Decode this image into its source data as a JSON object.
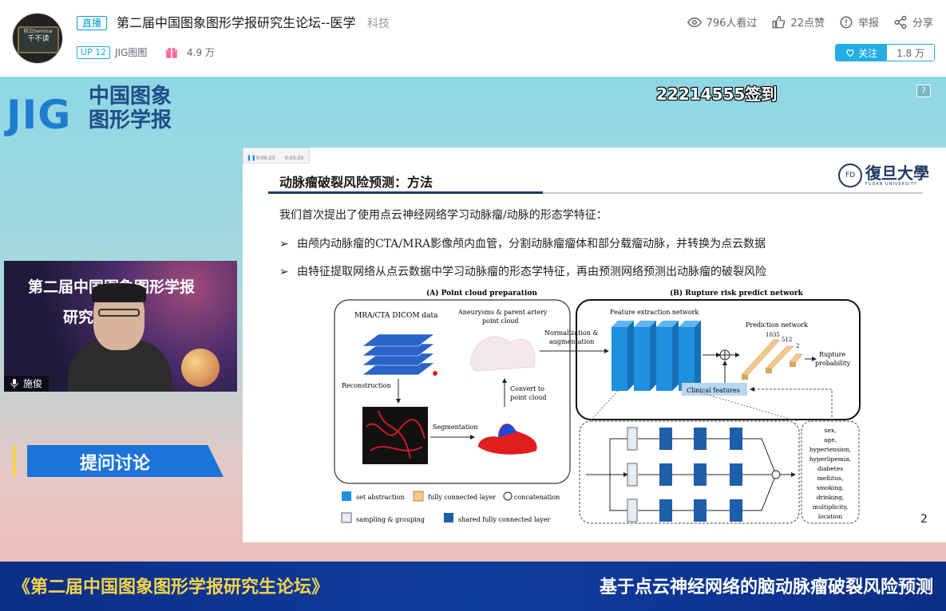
{
  "header": {
    "avatar_text_small": "前沿Seminar",
    "avatar_text_main": "千不读",
    "live_tag": "直播",
    "title": "第二届中国图象图形学报研究生论坛--医学",
    "area": "科技",
    "views": "796人看过",
    "likes": "22点赞",
    "report": "举报",
    "share": "分享",
    "up_level": "UP 12",
    "up_name": "JIG图图",
    "gift_count": "4.9 万",
    "follow_label": "关注",
    "follower_count": "1.8 万"
  },
  "stream": {
    "logo_mark": "JIG",
    "logo_cn_line1": "中国图象",
    "logo_cn_line2": "图形学报",
    "signin_text": "22214555签到",
    "help_label": "?",
    "cam": {
      "title_line1": "第二届中国图象图形学报",
      "title_line2": "研究生论坛",
      "speaker_name": "施俊"
    },
    "discuss_label": "提问讨论",
    "side_toggle": "☰",
    "banner_left": "《第二届中国图象图形学报研究生论坛》",
    "banner_right": "基于点云神经网络的脑动脉瘤破裂风险预测"
  },
  "slide": {
    "player_time_a": "0:00:23",
    "player_time_b": "0:03:20",
    "title": "动脉瘤破裂风险预测：方法",
    "university_cn": "復旦大學",
    "university_en": "FUDAN UNIVERSITY",
    "intro": "我们首次提出了使用点云神经网络学习动脉瘤/动脉的形态学特征：",
    "bullets": [
      "由颅内动脉瘤的CTA/MRA影像颅内血管，分割动脉瘤瘤体和部分载瘤动脉，并转换为点云数据",
      "由特征提取网络从点云数据中学习动脉瘤的形态学特征，再由预测网络预测出动脉瘤的破裂风险"
    ],
    "page_number": "2",
    "diagram": {
      "panel_a_title": "(A) Point cloud preparation",
      "panel_b_title": "(B) Rupture risk predict network",
      "dicom": "MRA/CTA DICOM data",
      "aneurysm_1": "Aneurysms & parent artery",
      "aneurysm_2": "point cloud",
      "reconstruction": "Reconstruction",
      "segmentation": "Segmentation",
      "convert_1": "Convert to",
      "convert_2": "point cloud",
      "norm_1": "Normalization &",
      "norm_2": "augmentation",
      "feature_net": "Feature extraction network",
      "prediction_net": "Prediction network",
      "n1035": "1035",
      "n512": "512",
      "n2": "2",
      "rupture_1": "Rupture",
      "rupture_2": "probability",
      "clinical": "Clinical features",
      "clinical_list": [
        "sex,",
        "age,",
        "hypertension,",
        "hyperlipemia,",
        "diabetes",
        "mellitus,",
        "smoking,",
        "drinking,",
        "multiplicity,",
        "location"
      ],
      "legend_set_abstraction": "set abstraction",
      "legend_fc": "fully connected layer",
      "legend_concat": "concatenation",
      "legend_sampling": "sampling & grouping",
      "legend_shared_fc": "shared fully connected layer"
    }
  },
  "colors": {
    "accent": "#23ade5",
    "banner_bg": "#0f3d9e",
    "banner_left_text": "#f2d44a",
    "discuss_bg": "#1d74d8",
    "slide_navy": "#1f3864",
    "cube_blue": "#1f8fe0"
  }
}
